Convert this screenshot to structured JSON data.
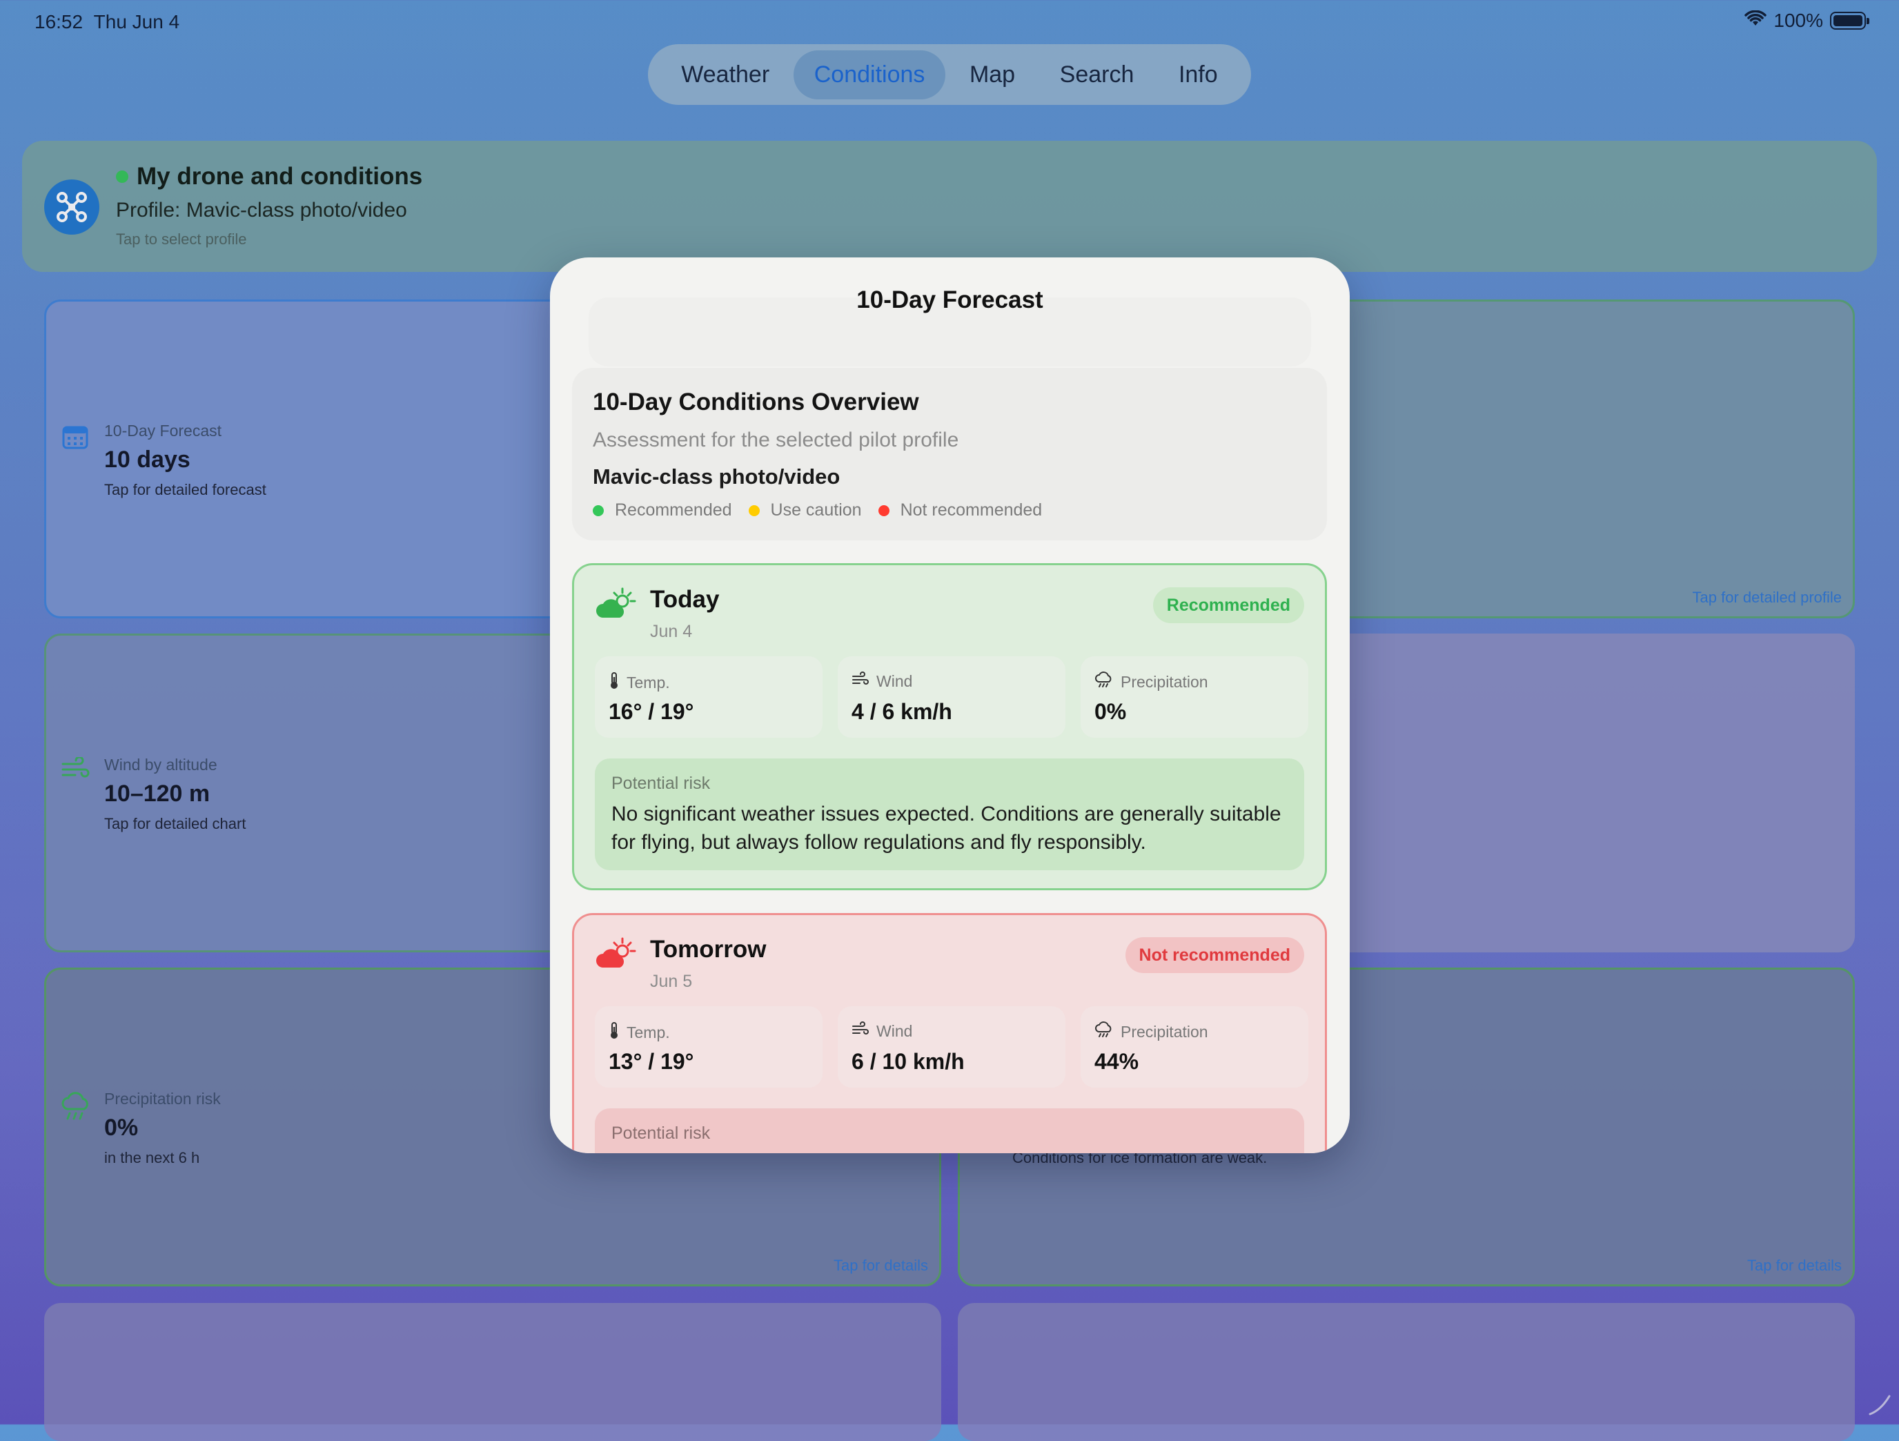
{
  "status": {
    "time": "16:52",
    "date": "Thu Jun 4",
    "battery": "100%"
  },
  "tabs": [
    {
      "label": "Weather",
      "active": false
    },
    {
      "label": "Conditions",
      "active": true
    },
    {
      "label": "Map",
      "active": false
    },
    {
      "label": "Search",
      "active": false
    },
    {
      "label": "Info",
      "active": false
    }
  ],
  "profile_bar": {
    "title": "My drone and conditions",
    "profile": "Profile: Mavic-class photo/video",
    "hint": "Tap to select profile"
  },
  "cards": {
    "forecast": {
      "label": "10-Day Forecast",
      "value": "10 days",
      "sub": "Tap for detailed forecast"
    },
    "profile_link": "Tap for detailed profile",
    "wind": {
      "label": "Wind by altitude",
      "value": "10–120 m",
      "sub": "Tap for detailed chart"
    },
    "precip": {
      "label": "Precipitation risk",
      "value": "0%",
      "sub": "in the next 6 h",
      "link": "Tap for details"
    },
    "icing": {
      "sub": "Conditions for ice formation are weak.",
      "link": "Tap for details"
    }
  },
  "modal": {
    "title": "10-Day Forecast",
    "overview": {
      "title": "10-Day Conditions Overview",
      "subtitle": "Assessment for the selected pilot profile",
      "profile": "Mavic-class photo/video",
      "legend": [
        {
          "label": "Recommended",
          "color": "#34c759"
        },
        {
          "label": "Use caution",
          "color": "#ffcc00"
        },
        {
          "label": "Not recommended",
          "color": "#ff3b30"
        }
      ]
    },
    "days": [
      {
        "name": "Today",
        "date": "Jun 4",
        "status": "Recommended",
        "temp_label": "Temp.",
        "temp": "16° / 19°",
        "wind_label": "Wind",
        "wind": "4 / 6 km/h",
        "precip_label": "Precipitation",
        "precip": "0%",
        "risk_label": "Potential risk",
        "risk_text": "No significant weather issues expected. Conditions are generally suitable for flying, but always follow regulations and fly responsibly."
      },
      {
        "name": "Tomorrow",
        "date": "Jun 5",
        "status": "Not recommended",
        "temp_label": "Temp.",
        "temp": "13° / 19°",
        "wind_label": "Wind",
        "wind": "6 / 10 km/h",
        "precip_label": "Precipitation",
        "precip": "44%",
        "risk_label": "Potential risk"
      }
    ]
  },
  "icons": [
    "wifi-icon",
    "battery-icon",
    "drone-icon",
    "calendar-icon",
    "wind-icon",
    "rain-cloud-icon",
    "partly-sunny-icon",
    "thermometer-icon",
    "cloud-rain-icon"
  ],
  "colors": {
    "recommended": "#34c759",
    "caution": "#ffcc00",
    "not_recommended": "#ff3b30",
    "accent": "#1767d8"
  }
}
